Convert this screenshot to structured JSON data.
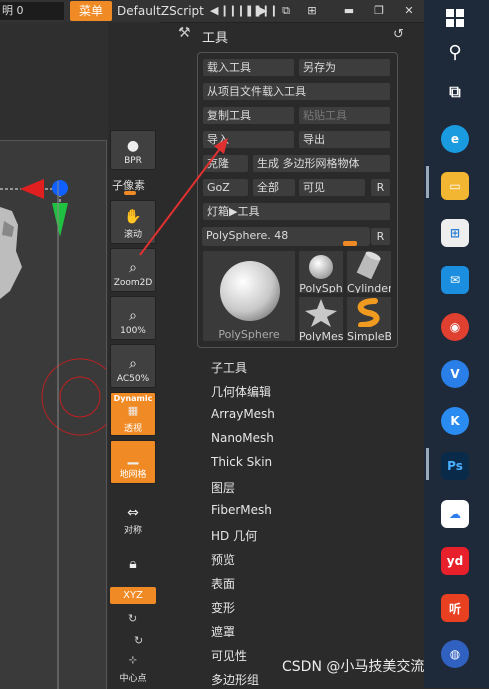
{
  "topbar": {
    "brush_field": "明 0",
    "menu_label": "菜单",
    "script_label": "DefaultZScript"
  },
  "shelf": {
    "bpr": "BPR",
    "subpixel": "子像素",
    "scroll": "滚动",
    "zoom2d": "Zoom2D",
    "zoom100": "100%",
    "ac50": "AC50%",
    "dynamic": "Dynamic",
    "perspective": "透视",
    "floor": "地网格",
    "symmetry": "对称",
    "xyz": "XYZ",
    "center": "中心点"
  },
  "tool": {
    "title": "工具",
    "buttons": {
      "load_tool": "载入工具",
      "save_as": "另存为",
      "load_from_project": "从项目文件载入工具",
      "copy_tool": "复制工具",
      "paste_tool": "粘贴工具",
      "import": "导入",
      "export": "导出",
      "clone": "克隆",
      "make_polymesh": "生成 多边形网格物体",
      "goz": "GoZ",
      "all": "全部",
      "visible": "可见",
      "r": "R",
      "lightbox_tools": "灯箱▶工具",
      "r2": "R"
    },
    "slider_label": "PolySphere. 48",
    "slider_fraction": 0.92,
    "thumbnails": {
      "main": "PolySphere",
      "polysph": "PolySph",
      "cylinder": "Cylinder",
      "polymesh": "PolyMes",
      "simpleb": "SimpleB"
    },
    "menu": [
      "子工具",
      "几何体编辑",
      "ArrayMesh",
      "NanoMesh",
      "Thick Skin",
      "图层",
      "FiberMesh",
      "HD 几何",
      "预览",
      "表面",
      "变形",
      "遮罩",
      "可见性",
      "多边形组"
    ]
  },
  "watermark": "CSDN @小马技美交流",
  "taskbar_apps": [
    "Ps",
    "yd",
    "听"
  ],
  "colors": {
    "accent": "#f08a24",
    "arrow": "#e03030"
  }
}
